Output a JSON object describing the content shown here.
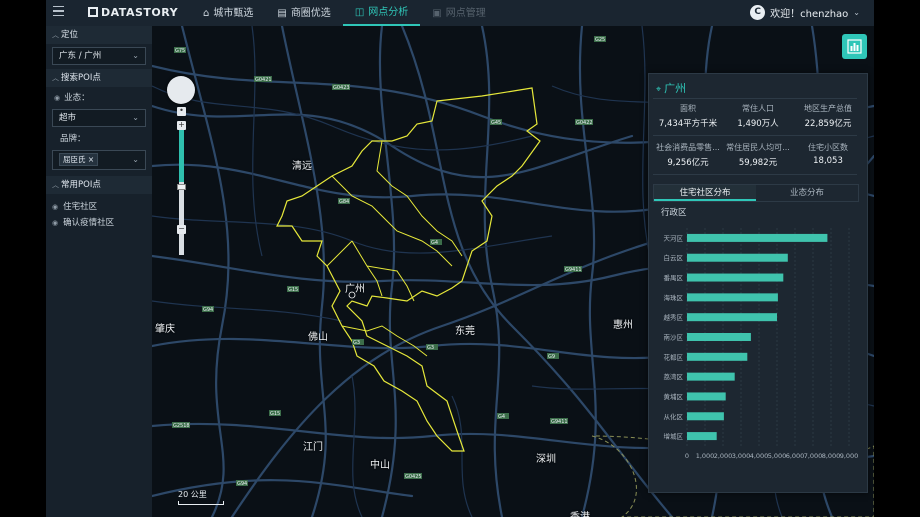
{
  "header": {
    "logo": "DATASTORY",
    "nav": [
      {
        "label": "城市甄选",
        "icon": "city-icon",
        "state": "normal"
      },
      {
        "label": "商圈优选",
        "icon": "store-icon",
        "state": "normal"
      },
      {
        "label": "网点分析",
        "icon": "network-icon",
        "state": "active"
      },
      {
        "label": "网点管理",
        "icon": "manage-icon",
        "state": "disabled"
      }
    ],
    "user": {
      "avatar_letter": "C",
      "greeting": "欢迎！chenzhao"
    }
  },
  "sidebar": {
    "location_title": "定位",
    "location_value": "广东 / 广州",
    "poi_title": "搜索POI点",
    "business_label": "业态：",
    "business_value": "超市",
    "brand_label": "品牌：",
    "brand_tag": "屈臣氏",
    "common_poi_title": "常用POI点",
    "common_poi_items": [
      "住宅社区",
      "确认疫情社区"
    ]
  },
  "map": {
    "cities": [
      "清远",
      "广州",
      "肇庆",
      "佛山",
      "东莞",
      "惠州",
      "江门",
      "中山",
      "深圳",
      "香港"
    ],
    "scale_label": "20 公里",
    "colors": {
      "boundary": "#e6e83a",
      "road": "#3a5a7e",
      "accent": "#2fc6b8"
    }
  },
  "panel": {
    "title": "广州",
    "stats": [
      {
        "label": "面积",
        "value": "7,434平方千米"
      },
      {
        "label": "常住人口",
        "value": "1,490万人"
      },
      {
        "label": "地区生产总值",
        "value": "22,859亿元"
      },
      {
        "label": "社会消费品零售...",
        "value": "9,256亿元"
      },
      {
        "label": "常住居民人均可...",
        "value": "59,982元"
      },
      {
        "label": "住宅小区数",
        "value": "18,053"
      }
    ],
    "tabs": [
      "住宅社区分布",
      "业态分布"
    ],
    "active_tab": 0,
    "chart_subtitle": "行政区"
  },
  "chart_data": {
    "type": "bar",
    "orientation": "horizontal",
    "title": "行政区",
    "categories": [
      "天河区",
      "白云区",
      "番禺区",
      "海珠区",
      "越秀区",
      "南沙区",
      "花都区",
      "荔湾区",
      "黄埔区",
      "从化区",
      "增城区"
    ],
    "values": [
      7800,
      5600,
      5350,
      5050,
      5000,
      3550,
      3350,
      2650,
      2150,
      2050,
      1650
    ],
    "xticks": [
      "0",
      "1,000",
      "2,000",
      "3,000",
      "4,000",
      "5,000",
      "6,000",
      "7,000",
      "8,000",
      "9,000"
    ],
    "xlim": [
      0,
      9000
    ],
    "bar_color": "#3fc3ad"
  }
}
